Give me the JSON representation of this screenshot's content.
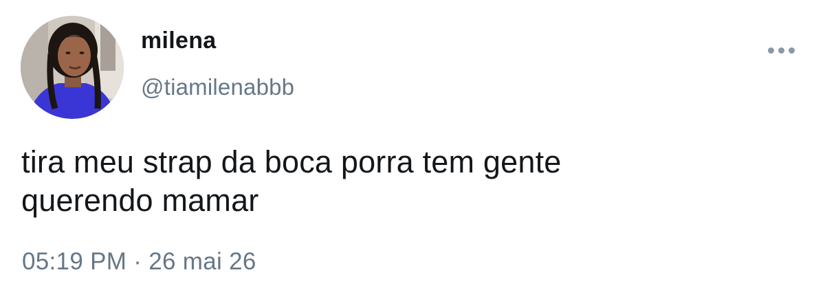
{
  "tweet": {
    "author": {
      "display_name": "milena",
      "handle": "@tiamilenabbb"
    },
    "menu_icon": "more-horizontal-icon",
    "text_lines": [
      "tira meu strap da boca porra tem gente",
      "querendo mamar"
    ],
    "timestamp": "05:19 PM · 26 mai 26"
  },
  "colors": {
    "text_primary": "#14171a",
    "text_secondary": "#657786",
    "icon_gray": "#8899a6",
    "background": "#ffffff"
  }
}
